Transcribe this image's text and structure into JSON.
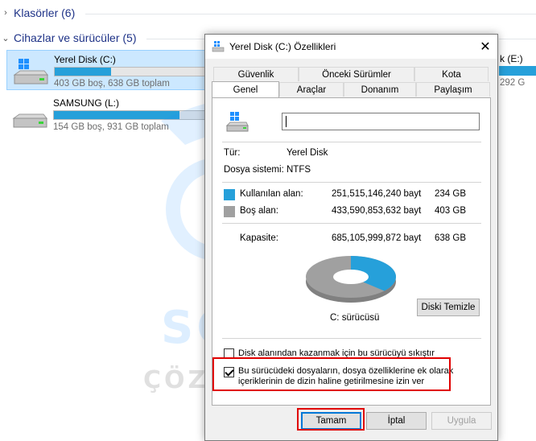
{
  "explorer": {
    "folders_section": "Klasörler (6)",
    "drives_section": "Cihazlar ve sürücüler (5)",
    "drives": [
      {
        "name": "Yerel Disk (C:)",
        "usage": "403 GB boş, 638 GB toplam",
        "used_fraction": 0.37
      },
      {
        "name": "SAMSUNG (L:)",
        "usage": "154 GB boş, 931 GB toplam",
        "used_fraction": 0.83
      }
    ],
    "partial_drive": {
      "name": "k (E:)",
      "usage": "292 G"
    }
  },
  "dialog": {
    "title": "Yerel Disk (C:) Özellikleri",
    "close_symbol": "✕",
    "tabs_row1": [
      "Güvenlik",
      "Önceki Sürümler",
      "Kota"
    ],
    "tabs_row2": [
      "Genel",
      "Araçlar",
      "Donanım",
      "Paylaşım"
    ],
    "active_tab": "Genel",
    "name_value": "",
    "type_label": "Tür:",
    "type_value": "Yerel Disk",
    "fs_label": "Dosya sistemi:",
    "fs_value": "NTFS",
    "used_label": "Kullanılan alan:",
    "used_bytes": "251,515,146,240 bayt",
    "used_gb": "234 GB",
    "free_label": "Boş alan:",
    "free_bytes": "433,590,853,632 bayt",
    "free_gb": "403 GB",
    "capacity_label": "Kapasite:",
    "capacity_bytes": "685,105,999,872 bayt",
    "capacity_gb": "638 GB",
    "drive_caption": "C: sürücüsü",
    "cleanup_button": "Diski Temizle",
    "compress_label": "Disk alanından kazanmak için bu sürücüyü sıkıştır",
    "compress_checked": false,
    "index_label_line1": "Bu sürücüdeki dosyaların, dosya özelliklerine ek olarak",
    "index_label_line2": "içeriklerinin de dizin haline getirilmesine izin ver",
    "index_checked": true,
    "ok_button": "Tamam",
    "cancel_button": "İptal",
    "apply_button": "Uygula",
    "used_fraction": 0.367
  },
  "watermark": {
    "line1": "SORUN",
    "line2": "ÇÖZÜMLERİ.NET"
  },
  "colors": {
    "used": "#26a0da",
    "free": "#a0a0a0",
    "selection_bg": "#cce8ff",
    "highlight_box": "#e00000",
    "section_text": "#1e3287"
  }
}
